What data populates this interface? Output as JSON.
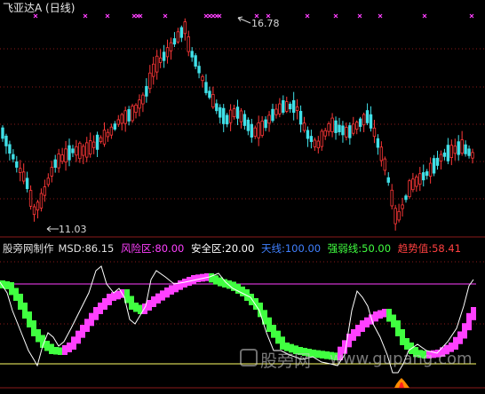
{
  "header": {
    "title": "飞亚达A (日线)"
  },
  "price_panel": {
    "high_label": "16.78",
    "low_label": "11.03",
    "colors": {
      "up": "#ff3838",
      "down": "#40e0e8",
      "dotted": "#8a1a1a",
      "marker": "#ff40ff"
    }
  },
  "indicator_bar": {
    "name": "股旁网制作",
    "msd_label": "MSD:",
    "msd_value": "86.15",
    "risk_label": "风险区:",
    "risk_value": "80.00",
    "safe_label": "安全区:",
    "safe_value": "20.00",
    "sky_label": "天线:",
    "sky_value": "100.00",
    "strength_label": "强弱线:",
    "strength_value": "50.00",
    "trend_label": "趋势值:",
    "trend_value": "58.41",
    "colors": {
      "risk": "#ff40ff",
      "safe": "#ffffff",
      "sky": "#4080ff",
      "strength": "#40ff40",
      "trend": "#ff4040",
      "risk_line": "#ff40ff",
      "safe_line": "#ffff66"
    }
  },
  "watermark": {
    "cn": "股旁网",
    "url": "www.gupang.com"
  }
}
